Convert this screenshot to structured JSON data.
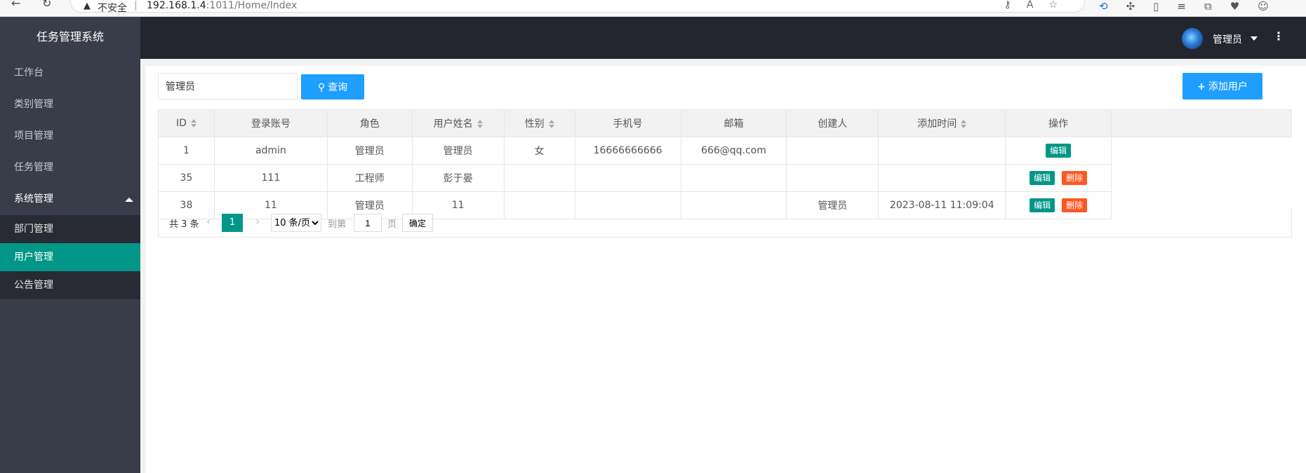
{
  "browser": {
    "security_warning": "不安全",
    "url_host": "192.168.1.4",
    "url_path": ":1011/Home/Index"
  },
  "sidebar": {
    "title": "任务管理系统",
    "items": [
      {
        "label": "工作台"
      },
      {
        "label": "类别管理"
      },
      {
        "label": "项目管理"
      },
      {
        "label": "任务管理"
      }
    ],
    "group": {
      "label": "系统管理",
      "children": [
        {
          "label": "部门管理"
        },
        {
          "label": "用户管理"
        },
        {
          "label": "公告管理"
        }
      ]
    }
  },
  "header": {
    "user_name": "管理员"
  },
  "toolbar": {
    "search_value": "管理员",
    "search_button": "查询",
    "add_button": "添加用户"
  },
  "table": {
    "columns": [
      "ID",
      "登录账号",
      "角色",
      "用户姓名",
      "性别",
      "手机号",
      "邮箱",
      "创建人",
      "添加时间",
      "操作"
    ],
    "rows": [
      {
        "id": "1",
        "account": "admin",
        "role": "管理员",
        "name": "管理员",
        "gender": "女",
        "phone": "16666666666",
        "email": "666@qq.com",
        "creator": "",
        "added": ""
      },
      {
        "id": "35",
        "account": "111",
        "role": "工程师",
        "name": "彭于晏",
        "gender": "",
        "phone": "",
        "email": "",
        "creator": "",
        "added": ""
      },
      {
        "id": "38",
        "account": "11",
        "role": "管理员",
        "name": "11",
        "gender": "",
        "phone": "",
        "email": "",
        "creator": "管理员",
        "added": "2023-08-11 11:09:04"
      }
    ],
    "edit_label": "编辑",
    "delete_label": "删除"
  },
  "pager": {
    "total": "共 3 条",
    "current": "1",
    "page_size": "10 条/页",
    "goto_label": "到第",
    "goto_value": "1",
    "page_label": "页",
    "confirm": "确定"
  },
  "colors": {
    "sidebar_bg": "#393d49",
    "header_bg": "#23262e",
    "active_green": "#009688",
    "primary_blue": "#1e9fff",
    "danger_orange": "#ff5722"
  }
}
